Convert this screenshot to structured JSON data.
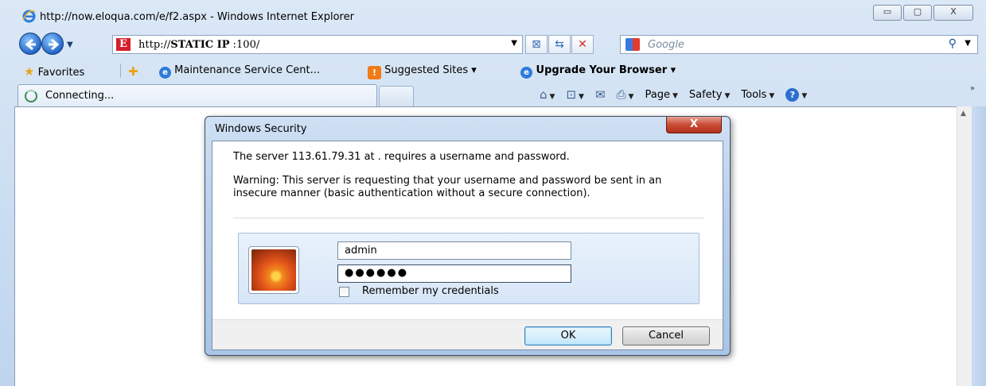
{
  "window": {
    "title": "http://now.eloqua.com/e/f2.aspx - Windows Internet Explorer",
    "controls": {
      "minimize": "▭",
      "maximize": "▢",
      "close": "X"
    }
  },
  "navbar": {
    "address_prefix": "http://",
    "address_bold": "STATIC IP",
    "address_suffix": " :100/",
    "search_placeholder": "Google"
  },
  "favorites_bar": {
    "favorites_label": "Favorites",
    "items": [
      {
        "label": "Maintenance Service Cent..."
      },
      {
        "label": "Suggested Sites ▾"
      },
      {
        "label": "Upgrade Your Browser ▾"
      }
    ]
  },
  "command_bar": {
    "tab_title": "Connecting...",
    "page_label": "Page",
    "safety_label": "Safety",
    "tools_label": "Tools"
  },
  "dialog": {
    "title": "Windows Security",
    "close_label": "X",
    "message": "The server 113.61.79.31 at . requires a username and password.",
    "warning": "Warning: This server is requesting that your username and password be sent in an insecure manner (basic authentication without a secure connection).",
    "username": "admin",
    "password_mask": "●●●●●●",
    "remember_label": "Remember my credentials",
    "remember_checked": false,
    "ok_label": "OK",
    "cancel_label": "Cancel"
  },
  "colors": {
    "chrome_blue": "#c9dcf1",
    "close_red": "#c94c35",
    "ok_blue": "#3c7fb1"
  }
}
